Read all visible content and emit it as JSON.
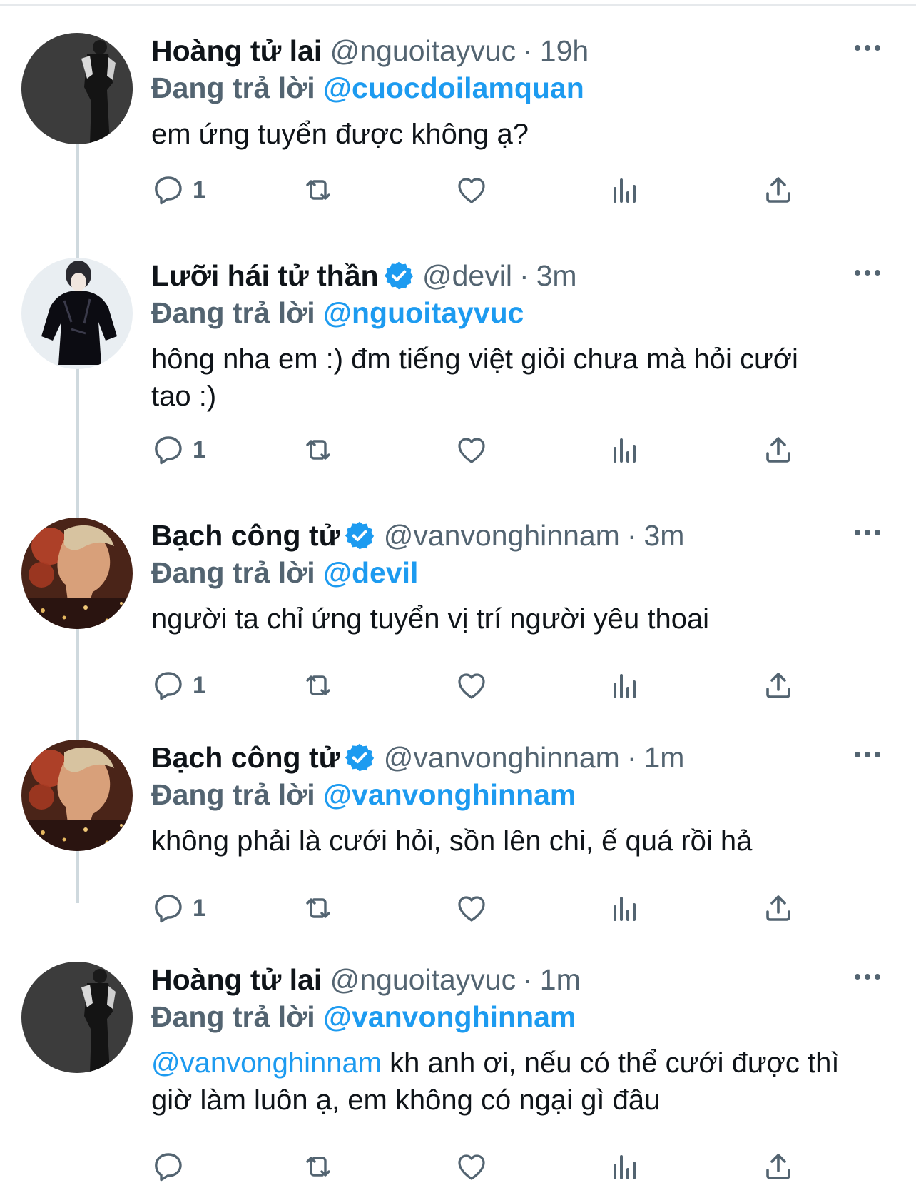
{
  "reply_prefix": "Đang trả lời",
  "tweets": [
    {
      "name": "Hoàng tử lai",
      "verified": false,
      "handle": "@nguoitayvuc",
      "separator": "·",
      "time": "19h",
      "reply_to": "@cuocdoilamquan",
      "text": "em ứng tuyển được không ạ?",
      "text_mention": "",
      "reply_count": "1",
      "avatar": "dark-figure"
    },
    {
      "name": "Lưỡi hái tử thần",
      "verified": true,
      "handle": "@devil",
      "separator": "·",
      "time": "3m",
      "reply_to": "@nguoitayvuc",
      "text": "hông nha em :) đm tiếng việt giỏi chưa mà hỏi cưới tao :)",
      "text_mention": "",
      "reply_count": "1",
      "avatar": "black-jacket"
    },
    {
      "name": "Bạch công tử",
      "verified": true,
      "handle": "@vanvonghinnam",
      "separator": "·",
      "time": "3m",
      "reply_to": "@devil",
      "text": "người ta chỉ ứng tuyển vị trí người yêu thoai",
      "text_mention": "",
      "reply_count": "1",
      "avatar": "red-flowers"
    },
    {
      "name": "Bạch công tử",
      "verified": true,
      "handle": "@vanvonghinnam",
      "separator": "·",
      "time": "1m",
      "reply_to": "@vanvonghinnam",
      "text": "không phải là cưới hỏi, sồn lên chi, ế quá rồi hả",
      "text_mention": "",
      "reply_count": "1",
      "avatar": "red-flowers"
    },
    {
      "name": "Hoàng tử lai",
      "verified": false,
      "handle": "@nguoitayvuc",
      "separator": "·",
      "time": "1m",
      "reply_to": "@vanvonghinnam",
      "text": " kh anh ơi, nếu có thể cưới được thì giờ làm luôn ạ, em không có ngại gì đâu",
      "text_mention": "@vanvonghinnam",
      "reply_count": "",
      "avatar": "dark-figure"
    }
  ],
  "colors": {
    "accent": "#1d9bf0",
    "secondary_text": "#536471",
    "primary_text": "#0f1419",
    "thread_line": "#cfd9de"
  },
  "icons": [
    "more-icon",
    "reply-icon",
    "retweet-icon",
    "like-icon",
    "analytics-icon",
    "share-icon",
    "verified-badge-icon"
  ]
}
